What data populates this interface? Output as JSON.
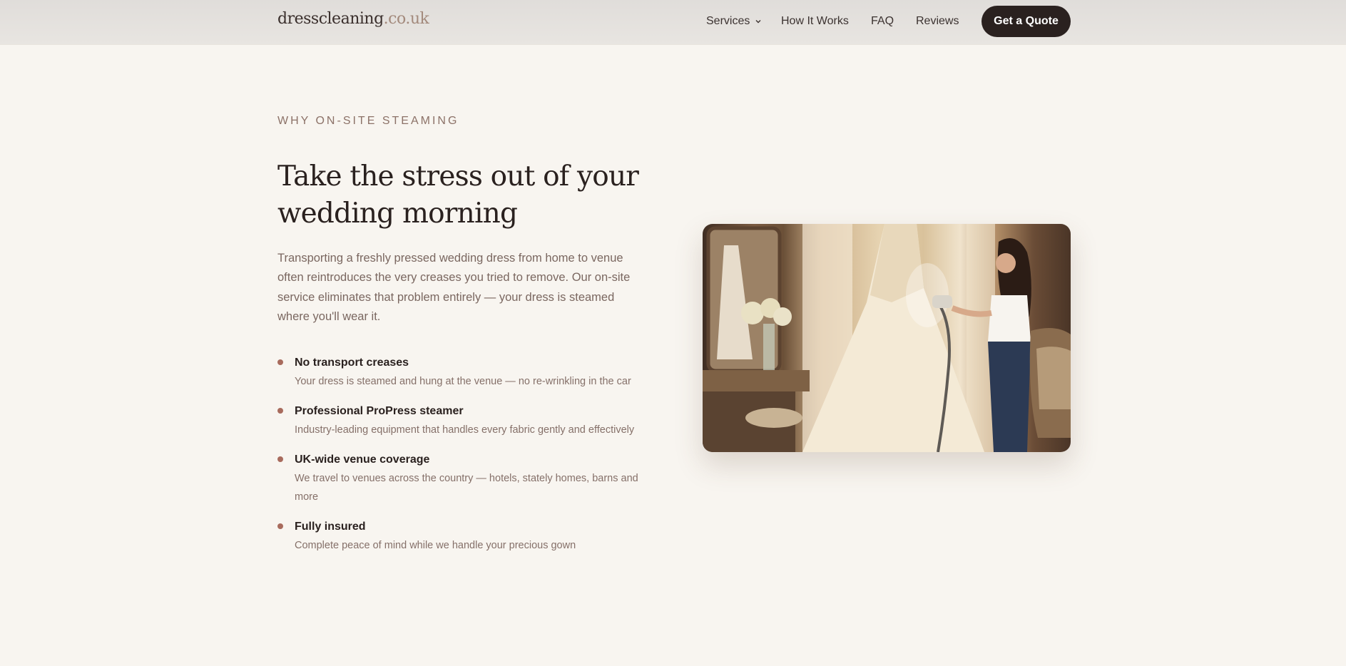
{
  "brand": {
    "name": "dresscleaning",
    "tld": ".co.uk"
  },
  "nav": {
    "items": [
      "Services",
      "How It Works",
      "FAQ",
      "Reviews"
    ],
    "cta_label": "Get a Quote"
  },
  "section": {
    "eyebrow": "WHY ON-SITE STEAMING",
    "headline_line1": "Take the stress out of your",
    "headline_line2": "wedding morning",
    "intro": "Transporting a freshly pressed wedding dress from home to venue often reintroduces the very creases you tried to remove. Our on-site service eliminates that problem entirely — your dress is steamed where you'll wear it.",
    "features": [
      {
        "title": "No transport creases",
        "desc": "Your dress is steamed and hung at the venue — no re-wrinkling in the car"
      },
      {
        "title": "Professional ProPress steamer",
        "desc": "Industry-leading equipment that handles every fabric gently and effectively"
      },
      {
        "title": "UK-wide venue coverage",
        "desc": "We travel to venues across the country — hotels, stately homes, barns and more"
      },
      {
        "title": "Fully insured",
        "desc": "Complete peace of mind while we handle your precious gown"
      }
    ]
  },
  "colors": {
    "accent": "#a86b5d",
    "button_bg": "#2a211f",
    "background": "#f8f5f0",
    "nav_bg": "#e3e0dc"
  },
  "icons": {
    "services_dropdown": "chevron-down-icon",
    "feature_bullet": "dot"
  }
}
